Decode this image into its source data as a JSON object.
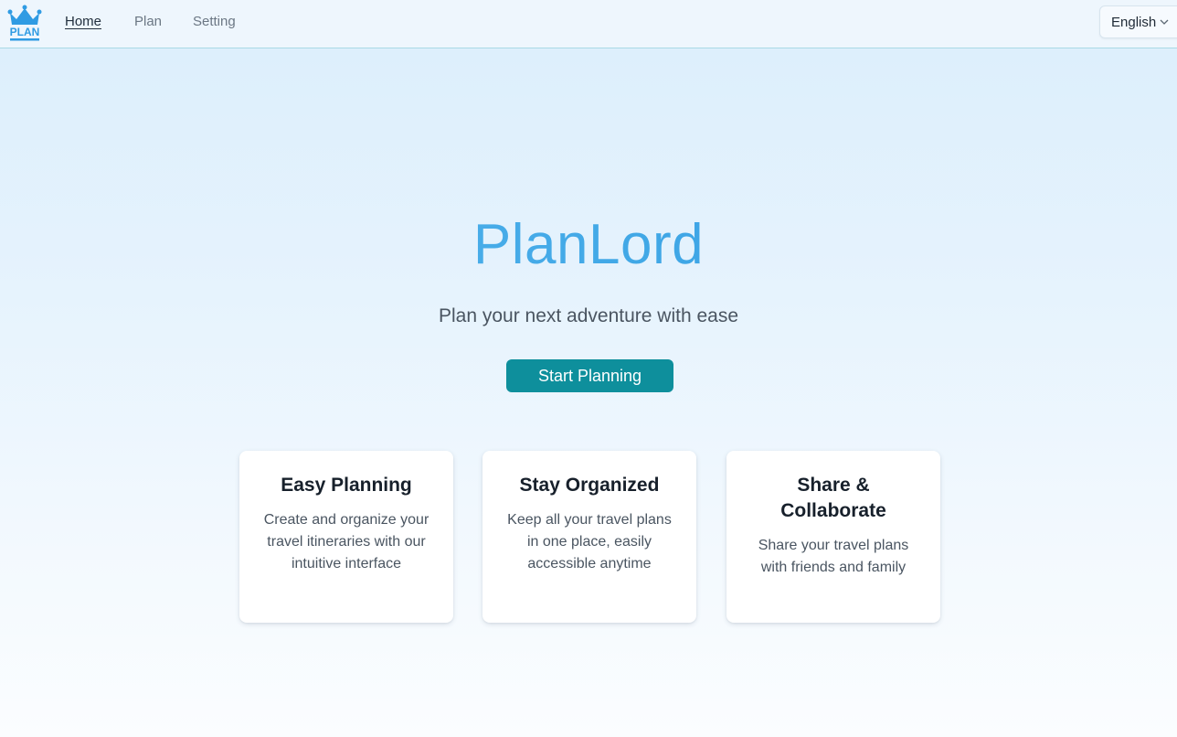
{
  "nav": {
    "logo_text": "PLAN",
    "links": [
      "Home",
      "Plan",
      "Setting"
    ],
    "active": "Home",
    "language": "English"
  },
  "hero": {
    "title": "PlanLord",
    "subtitle": "Plan your next adventure with ease",
    "cta_label": "Start Planning"
  },
  "features": [
    {
      "title": "Easy Planning",
      "description": "Create and organize your travel itineraries with our intuitive interface"
    },
    {
      "title": "Stay Organized",
      "description": "Keep all your travel plans in one place, easily accessible anytime"
    },
    {
      "title": "Share & Collaborate",
      "description": "Share your travel plans with friends and family"
    }
  ],
  "colors": {
    "accent": "#2c9ae0",
    "button": "#0e8f9c",
    "logo": "#2f9be3"
  }
}
